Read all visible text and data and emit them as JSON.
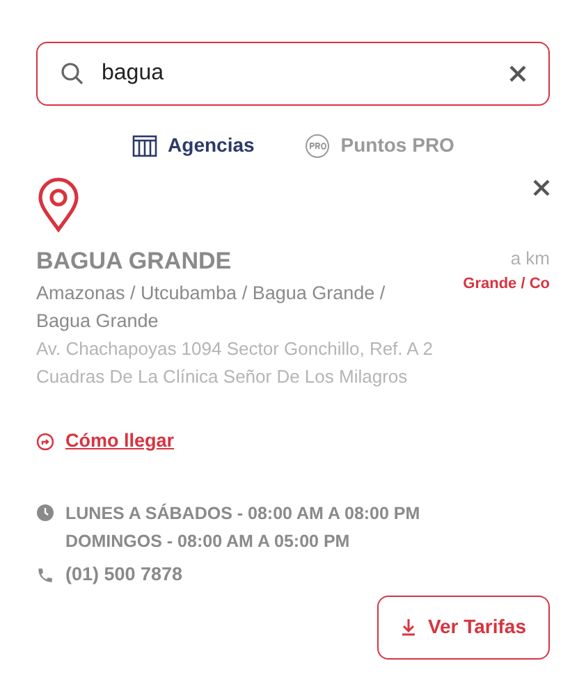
{
  "search": {
    "value": "bagua"
  },
  "tabs": [
    {
      "label": "Agencias",
      "kind": "agency",
      "selected": true
    },
    {
      "label": "Puntos PRO",
      "kind": "pro",
      "selected": false
    }
  ],
  "result": {
    "name": "BAGUA GRANDE",
    "region": "Amazonas / Utcubamba / Bagua Grande / Bagua Grande",
    "address": "Av. Chachapoyas 1094 Sector Gonchillo, Ref. A 2 Cuadras De La Clínica Señor De Los Milagros",
    "distance": "a km",
    "distance_place": "Grande / Co",
    "directions_link": "Cómo llegar",
    "hours": [
      "LUNES A SÁBADOS - 08:00 AM A 08:00 PM",
      "DOMINGOS - 08:00 AM A 05:00 PM"
    ],
    "phone": "(01) 500 7878",
    "rates_button": "Ver Tarifas"
  }
}
